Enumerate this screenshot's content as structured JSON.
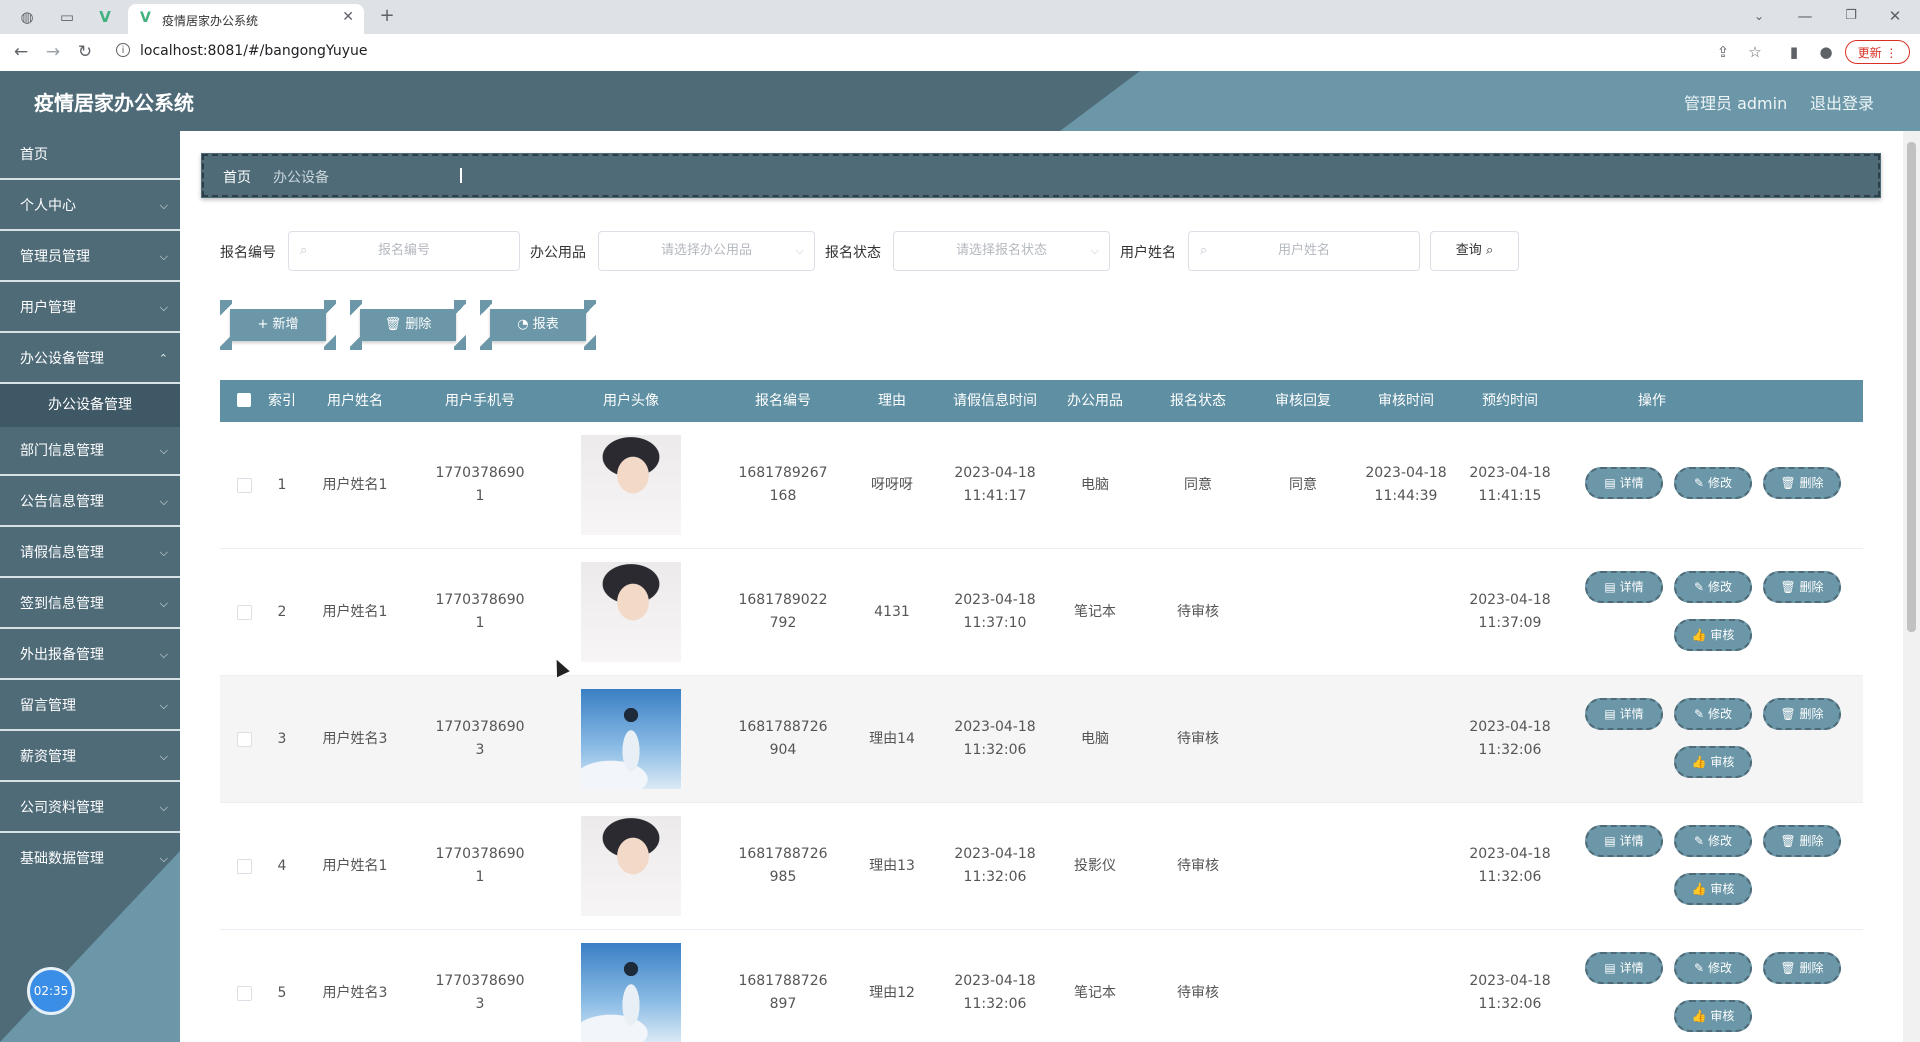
{
  "browser": {
    "tab_title": "疫情居家办公系统",
    "url": "localhost:8081/#/bangongYuyue",
    "update_label": "更新"
  },
  "header": {
    "title": "疫情居家办公系统",
    "user_label": "管理员 admin",
    "logout_label": "退出登录"
  },
  "sidebar": {
    "items": [
      {
        "label": "首页"
      },
      {
        "label": "个人中心"
      },
      {
        "label": "管理员管理"
      },
      {
        "label": "用户管理"
      },
      {
        "label": "办公设备管理"
      },
      {
        "label": "办公设备管理"
      },
      {
        "label": "部门信息管理"
      },
      {
        "label": "公告信息管理"
      },
      {
        "label": "请假信息管理"
      },
      {
        "label": "签到信息管理"
      },
      {
        "label": "外出报备管理"
      },
      {
        "label": "留言管理"
      },
      {
        "label": "薪资管理"
      },
      {
        "label": "公司资料管理"
      },
      {
        "label": "基础数据管理"
      }
    ],
    "clock": "02:35"
  },
  "breadcrumb": {
    "home": "首页",
    "current": "办公设备"
  },
  "search": {
    "label1": "报名编号",
    "placeholder1": "报名编号",
    "label2": "办公用品",
    "placeholder2": "请选择办公用品",
    "label3": "报名状态",
    "placeholder3": "请选择报名状态",
    "label4": "用户姓名",
    "placeholder4": "用户姓名",
    "query_label": "查询"
  },
  "actions": {
    "add": "新增",
    "delete": "删除",
    "report": "报表"
  },
  "table": {
    "headers": [
      "索引",
      "用户姓名",
      "用户手机号",
      "用户头像",
      "报名编号",
      "理由",
      "请假信息时间",
      "办公用品",
      "报名状态",
      "审核回复",
      "审核时间",
      "预约时间",
      "操作"
    ],
    "ops": {
      "detail": "详情",
      "edit": "修改",
      "delete": "删除",
      "audit": "审核"
    },
    "rows": [
      {
        "idx": "1",
        "name": "用户姓名1",
        "phone_a": "1770378690",
        "phone_b": "1",
        "no_a": "1681789267",
        "no_b": "168",
        "reason": "呀呀呀",
        "time_a": "2023-04-18",
        "time_b": "11:41:17",
        "item": "电脑",
        "status": "同意",
        "reply": "同意",
        "audit_a": "2023-04-18",
        "audit_b": "11:44:39",
        "book_a": "2023-04-18",
        "book_b": "11:41:15"
      },
      {
        "idx": "2",
        "name": "用户姓名1",
        "phone_a": "1770378690",
        "phone_b": "1",
        "no_a": "1681789022",
        "no_b": "792",
        "reason": "4131",
        "time_a": "2023-04-18",
        "time_b": "11:37:10",
        "item": "笔记本",
        "status": "待审核",
        "reply": "",
        "audit_a": "",
        "audit_b": "",
        "book_a": "2023-04-18",
        "book_b": "11:37:09"
      },
      {
        "idx": "3",
        "name": "用户姓名3",
        "phone_a": "1770378690",
        "phone_b": "3",
        "no_a": "1681788726",
        "no_b": "904",
        "reason": "理由14",
        "time_a": "2023-04-18",
        "time_b": "11:32:06",
        "item": "电脑",
        "status": "待审核",
        "reply": "",
        "audit_a": "",
        "audit_b": "",
        "book_a": "2023-04-18",
        "book_b": "11:32:06"
      },
      {
        "idx": "4",
        "name": "用户姓名1",
        "phone_a": "1770378690",
        "phone_b": "1",
        "no_a": "1681788726",
        "no_b": "985",
        "reason": "理由13",
        "time_a": "2023-04-18",
        "time_b": "11:32:06",
        "item": "投影仪",
        "status": "待审核",
        "reply": "",
        "audit_a": "",
        "audit_b": "",
        "book_a": "2023-04-18",
        "book_b": "11:32:06"
      },
      {
        "idx": "5",
        "name": "用户姓名3",
        "phone_a": "1770378690",
        "phone_b": "3",
        "no_a": "1681788726",
        "no_b": "897",
        "reason": "理由12",
        "time_a": "2023-04-18",
        "time_b": "11:32:06",
        "item": "笔记本",
        "status": "待审核",
        "reply": "",
        "audit_a": "",
        "audit_b": "",
        "book_a": "2023-04-18",
        "book_b": "11:32:06"
      }
    ]
  },
  "colors": {
    "header": "#4f6b78",
    "accent": "#6b97a8",
    "table_head": "#5f8fa3"
  }
}
